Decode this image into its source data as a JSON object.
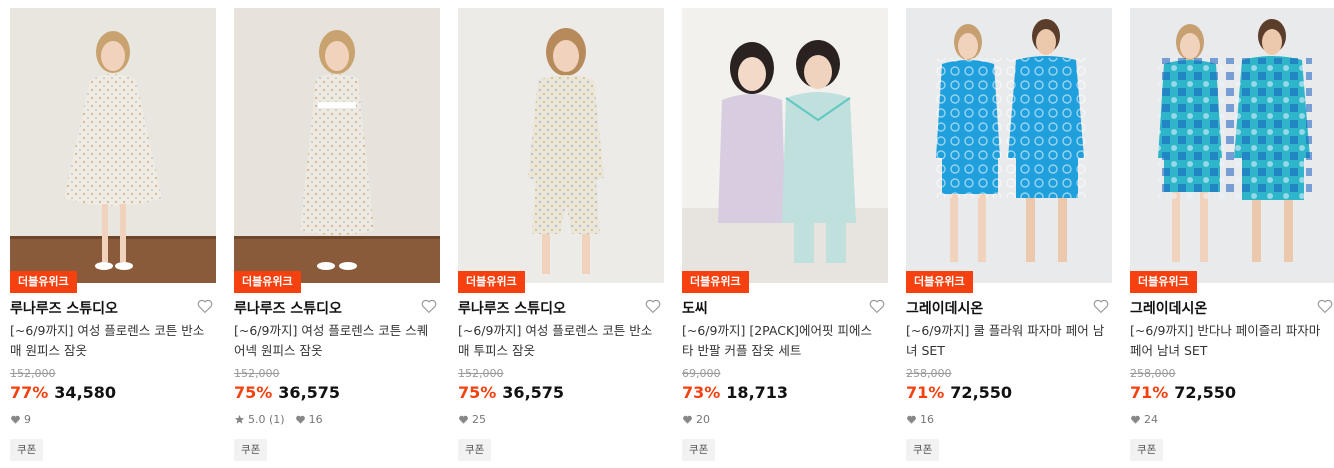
{
  "colors": {
    "accent": "#f5410f",
    "strike": "#9a9a9a",
    "coupon_bg": "#f2f2f2"
  },
  "products": [
    {
      "badge": "더블유위크",
      "brand": "루나루즈 스튜디오",
      "title": "[~6/9까지] 여성 플로렌스 코튼 반소매 원피스 잠옷",
      "original_price": "152,000",
      "discount": "77%",
      "price": "34,580",
      "rating": "",
      "review_count": "",
      "likes": "9",
      "coupon": "쿠폰",
      "image_desc": "woman in floral short-sleeve nightdress"
    },
    {
      "badge": "더블유위크",
      "brand": "루나루즈 스튜디오",
      "title": "[~6/9까지] 여성 플로렌스 코튼 스퀘어넥 원피스 잠옷",
      "original_price": "152,000",
      "discount": "75%",
      "price": "36,575",
      "rating": "5.0",
      "review_count": "(1)",
      "likes": "16",
      "coupon": "쿠폰",
      "image_desc": "woman in floral square-neck long nightdress"
    },
    {
      "badge": "더블유위크",
      "brand": "루나루즈 스튜디오",
      "title": "[~6/9까지] 여성 플로렌스 코튼 반소매 투피스 잠옷",
      "original_price": "152,000",
      "discount": "75%",
      "price": "36,575",
      "rating": "",
      "review_count": "",
      "likes": "25",
      "coupon": "쿠폰",
      "image_desc": "woman in floral two-piece pajamas"
    },
    {
      "badge": "더블유위크",
      "brand": "도씨",
      "title": "[~6/9까지] [2PACK]에어핏 피에스타 반팔 커플 잠옷 세트",
      "original_price": "69,000",
      "discount": "73%",
      "price": "18,713",
      "rating": "",
      "review_count": "",
      "likes": "20",
      "coupon": "쿠폰",
      "image_desc": "couple in pastel pajamas sitting"
    },
    {
      "badge": "더블유위크",
      "brand": "그레이데시온",
      "title": "[~6/9까지] 쿨 플라워 파자마 페어 남녀 SET",
      "original_price": "258,000",
      "discount": "71%",
      "price": "72,550",
      "rating": "",
      "review_count": "",
      "likes": "16",
      "coupon": "쿠폰",
      "image_desc": "couple in blue flower pattern pajama sets"
    },
    {
      "badge": "더블유위크",
      "brand": "그레이데시온",
      "title": "[~6/9까지] 반다나 페이즐리 파자마 페어 남녀 SET",
      "original_price": "258,000",
      "discount": "71%",
      "price": "72,550",
      "rating": "",
      "review_count": "",
      "likes": "24",
      "coupon": "쿠폰",
      "image_desc": "couple in blue bandana paisley pajama sets"
    }
  ],
  "icons": {
    "wishlist": "heart-outline-icon",
    "likes": "heart-filled-icon",
    "rating": "star-icon"
  }
}
